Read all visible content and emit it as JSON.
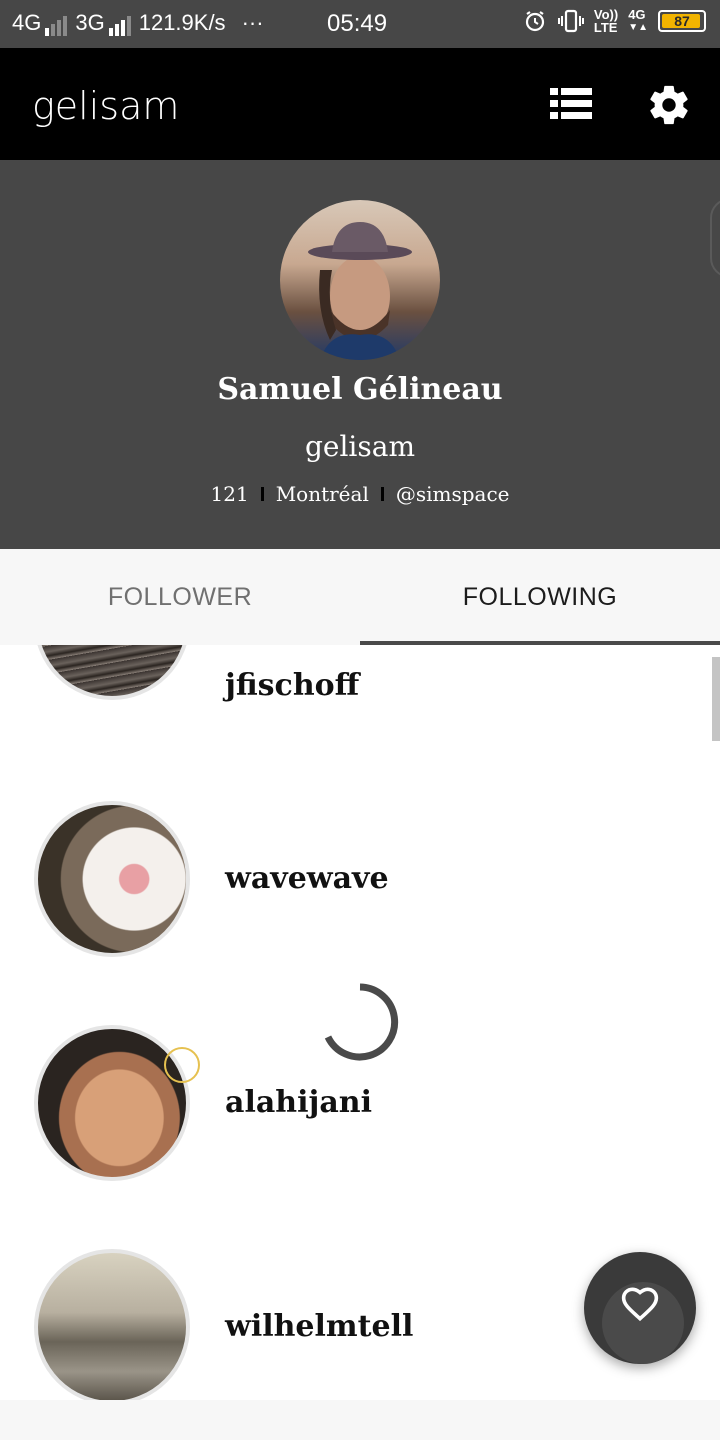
{
  "status_bar": {
    "net1": "4G",
    "net2": "3G",
    "speed": "121.9K/s",
    "dots": "···",
    "time": "05:49",
    "volte_top": "Vo))",
    "volte_bottom": "LTE",
    "net3": "4G",
    "battery": "87"
  },
  "app_bar": {
    "title": "gelisam",
    "list_icon": "list-view-icon",
    "settings_icon": "gear-icon"
  },
  "profile": {
    "name": "Samuel Gélineau",
    "username": "gelisam",
    "count": "121",
    "location": "Montréal",
    "twitter": "@simspace"
  },
  "tabs": [
    {
      "label": "FOLLOWER",
      "active": false
    },
    {
      "label": "FOLLOWING",
      "active": true
    }
  ],
  "following": [
    {
      "username": "jfischoff"
    },
    {
      "username": "wavewave"
    },
    {
      "username": "alahijani"
    },
    {
      "username": "wilhelmtell"
    }
  ],
  "fab": {
    "icon": "heart-icon"
  },
  "colors": {
    "status_bar": "#474747",
    "app_bar": "#000000",
    "profile_bg": "#474747",
    "tab_bg": "#f7f7f7",
    "battery": "#f2b400"
  }
}
